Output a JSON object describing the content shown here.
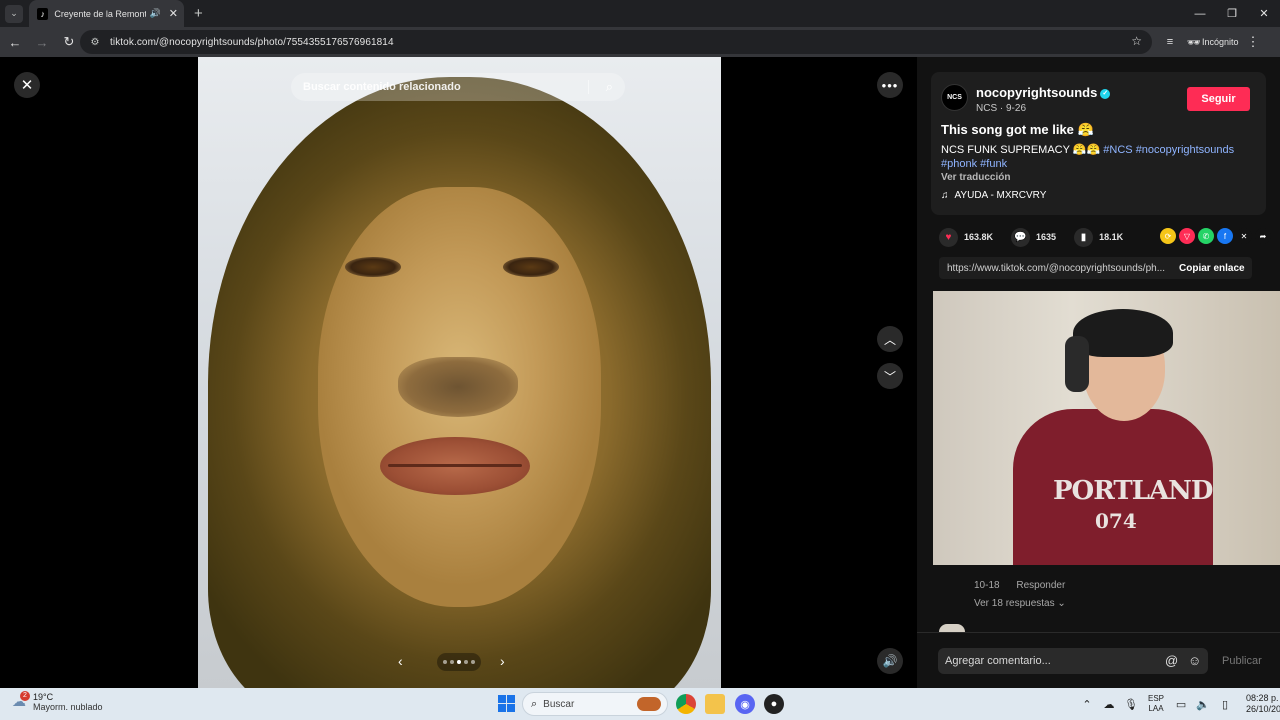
{
  "browser": {
    "tab_title": "Creyente de la Remontada",
    "new_tab": "+",
    "url": "tiktok.com/@nocopyrightsounds/photo/7554355176576961814",
    "incognito_label": "Incógnito"
  },
  "viewer": {
    "search_placeholder": "Buscar contenido relacionado",
    "carousel_total": 5,
    "carousel_active": 3
  },
  "author": {
    "avatar_text": "NCS",
    "name": "nocopyrightsounds",
    "sub": "NCS · 9-26",
    "follow_label": "Seguir"
  },
  "post": {
    "title": "This song got me like 😤",
    "desc_text": "NCS FUNK SUPREMACY 😤😤 ",
    "tag1": "#NCS",
    "tag2": "#nocopyrightsounds",
    "tag3": "#phonk",
    "tag4": "#funk",
    "translate_label": "Ver traducción",
    "music": "AYUDA - MXRCVRY"
  },
  "stats": {
    "likes": "163.8K",
    "comments": "1635",
    "saves": "18.1K"
  },
  "share": {
    "url": "https://www.tiktok.com/@nocopyrightsounds/ph...",
    "copy_label": "Copiar enlace"
  },
  "webcam": {
    "shirt_text": "PORTLAND",
    "shirt_number": "074"
  },
  "comment": {
    "date": "10-18",
    "reply_label": "Responder",
    "replies_label": "Ver 18 respuestas ⌄"
  },
  "composer": {
    "placeholder": "Agregar comentario...",
    "publish_label": "Publicar"
  },
  "taskbar": {
    "weather_badge": "2",
    "temperature": "19°C",
    "weather_desc": "Mayorm. nublado",
    "search_placeholder": "Buscar",
    "lang_line1": "ESP",
    "lang_line2": "LAA",
    "time": "08:28 p. m.",
    "date": "26/10/2025"
  }
}
